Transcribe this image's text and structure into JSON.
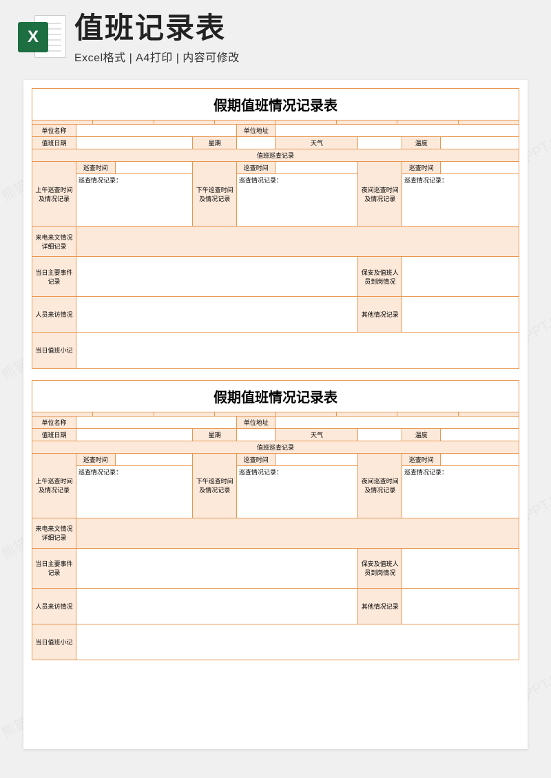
{
  "header": {
    "title": "值班记录表",
    "subtitle": "Excel格式 | A4打印 | 内容可修改",
    "icon_letter": "X"
  },
  "watermark_text": "熊猫办公 KUPPT.COM",
  "form": {
    "title": "假期值班情况记录表",
    "row1": {
      "unit_name_label": "单位名称",
      "unit_addr_label": "单位地址"
    },
    "row2": {
      "date_label": "值班日期",
      "week_label": "星期",
      "weather_label": "天气",
      "temp_label": "温度"
    },
    "patrol_section_label": "值班巡查记录",
    "patrol": {
      "time_label": "巡查时间",
      "record_label": "巡查情况记录：",
      "morning_label": "上午巡查时间及情况记录",
      "afternoon_label": "下午巡查时间及情况记录",
      "night_label": "夜间巡查时间及情况记录"
    },
    "rows": {
      "call_doc_label": "来电来文情况详细记录",
      "main_event_label": "当日主要事件记录",
      "security_label": "保安及值班人员到岗情况",
      "visitor_label": "人员来访情况",
      "other_label": "其他情况记录",
      "diary_label": "当日值班小记"
    }
  }
}
